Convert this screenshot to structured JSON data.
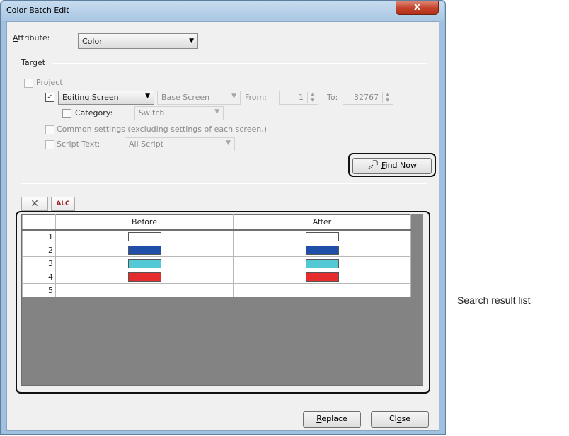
{
  "window": {
    "title": "Color Batch Edit",
    "close_glyph": "x"
  },
  "attribute": {
    "label": "Attribute:",
    "value": "Color"
  },
  "target": {
    "group_label": "Target",
    "project_label": "Project",
    "screen_type_value": "Editing Screen",
    "screen_kind_value": "Base Screen",
    "from_label": "From:",
    "from_value": "1",
    "to_label": "To:",
    "to_value": "32767",
    "category_label": "Category:",
    "category_value": "Switch",
    "common_settings_label": "Common settings (excluding settings of each screen.)",
    "script_text_label": "Script Text:",
    "script_value": "All Script"
  },
  "find_now_label": "Find Now",
  "toolbar": {
    "delete_icon": "x-icon",
    "delete_all_icon": "alc-delete-icon",
    "delete_all_text": "ALC"
  },
  "grid": {
    "columns": [
      "Before",
      "After"
    ],
    "rows": [
      {
        "num": "1",
        "before": "#ffffff",
        "after": "#ffffff"
      },
      {
        "num": "2",
        "before": "#1f4fa8",
        "after": "#1f4fa8"
      },
      {
        "num": "3",
        "before": "#54c9d6",
        "after": "#54c9d6"
      },
      {
        "num": "4",
        "before": "#e62d2d",
        "after": "#e62d2d"
      },
      {
        "num": "5",
        "before": "",
        "after": ""
      }
    ]
  },
  "annotation": {
    "label": "Search result list"
  },
  "buttons": {
    "replace_label": "Replace",
    "close_label": "Close"
  }
}
